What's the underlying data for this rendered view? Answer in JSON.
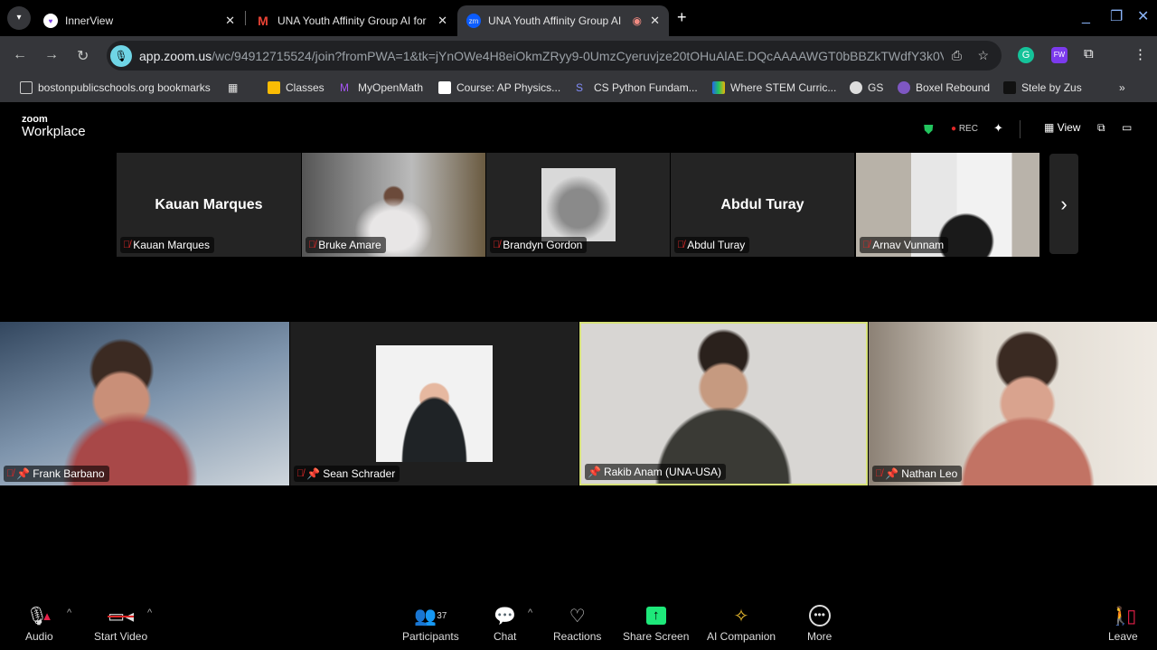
{
  "browser": {
    "tabs": [
      {
        "title": "InnerView",
        "active": false
      },
      {
        "title": "UNA Youth Affinity Group AI for",
        "active": false
      },
      {
        "title": "UNA Youth Affinity Group AI",
        "active": true
      }
    ],
    "url_host": "app.zoom.us",
    "url_path": "/wc/94912715524/join?fromPWA=1&tk=jYnOWe4H8eiOkmZRyy9-0UmzCyeruvjze20tOHuAlAE.DQcAAAAWGT0bBBZkTWdfY3k0V...",
    "bookmarks": [
      "bostonpublicschools.org bookmarks",
      "Classes",
      "MyOpenMath",
      "Course: AP Physics...",
      "CS Python Fundam...",
      "Where STEM Curric...",
      "GS",
      "Boxel Rebound",
      "Stele by Zus"
    ]
  },
  "zoom": {
    "logo_top": "zoom",
    "logo_bottom": "Workplace",
    "rec": "REC",
    "view": "View",
    "strip": [
      {
        "name": "Kauan Marques",
        "display": "Kauan Marques",
        "video": false
      },
      {
        "name": "Bruke Amare",
        "video": true
      },
      {
        "name": "Brandyn Gordon",
        "video": true
      },
      {
        "name": "Abdul Turay",
        "display": "Abdul Turay",
        "video": false
      },
      {
        "name": "Arnav Vunnam",
        "video": true
      }
    ],
    "gallery": [
      {
        "name": "Frank Barbano",
        "muted": true,
        "active": false
      },
      {
        "name": "Sean Schrader",
        "muted": true,
        "active": false
      },
      {
        "name": "Rakib Anam (UNA-USA)",
        "muted": false,
        "active": true
      },
      {
        "name": "Nathan Leo",
        "muted": true,
        "active": false
      }
    ],
    "toolbar": {
      "audio": "Audio",
      "video": "Start Video",
      "participants": "Participants",
      "participants_count": "37",
      "chat": "Chat",
      "reactions": "Reactions",
      "share": "Share Screen",
      "ai": "AI Companion",
      "more": "More",
      "leave": "Leave"
    },
    "colors": {
      "active_speaker": "#d7e27a",
      "share": "#1ee87a",
      "muted": "#e02828"
    }
  }
}
